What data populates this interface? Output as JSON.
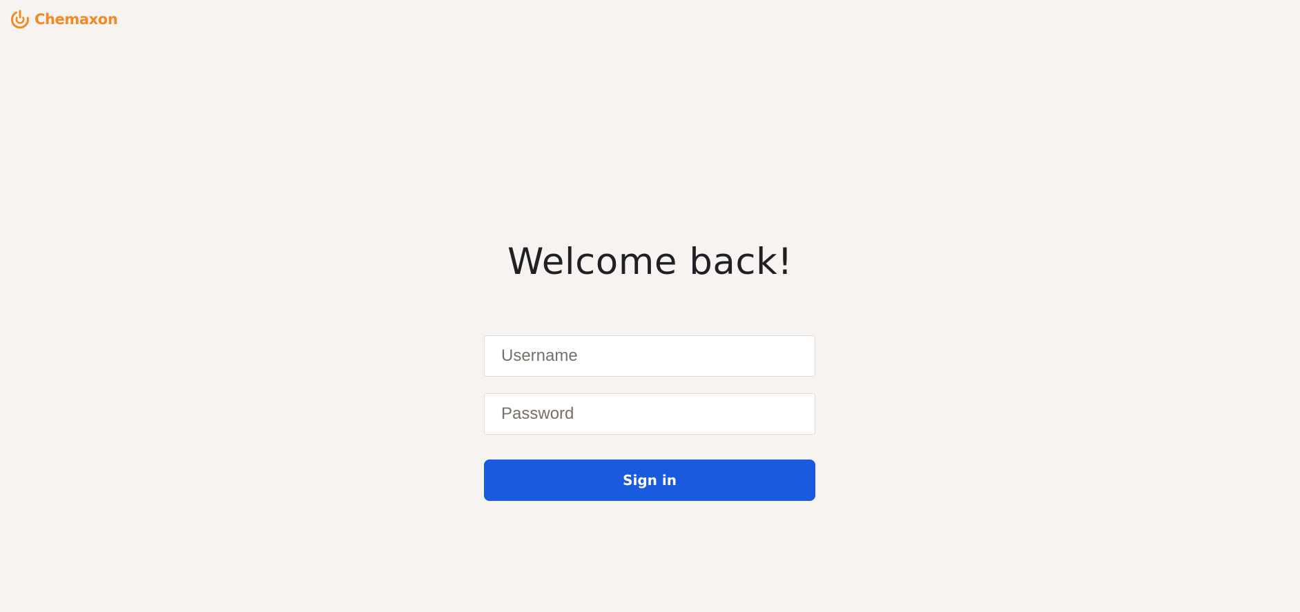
{
  "header": {
    "logo_text": "Chemaxon",
    "logo_icon": "chemaxon-logo-icon"
  },
  "main": {
    "title": "Welcome back!",
    "username": {
      "placeholder": "Username",
      "value": ""
    },
    "password": {
      "placeholder": "Password",
      "value": ""
    },
    "signin_label": "Sign in"
  },
  "colors": {
    "background": "#f7f3f0",
    "brand_orange": "#f08a24",
    "primary_button": "#1a5adf",
    "title_text": "#1f1f24"
  }
}
